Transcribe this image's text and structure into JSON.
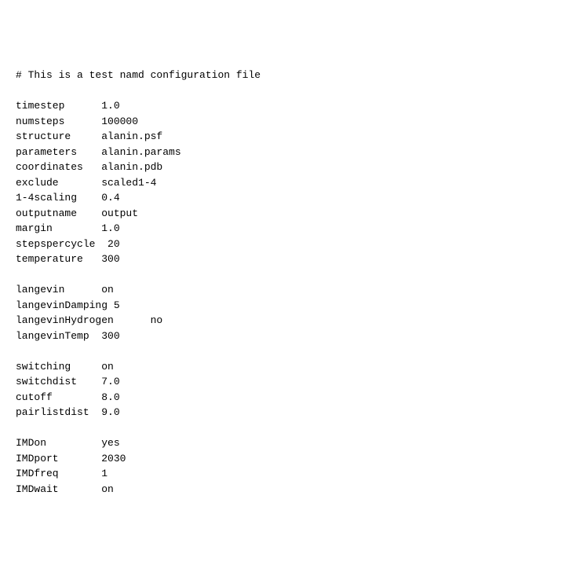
{
  "comment": "# This is a test namd configuration file",
  "blocks": [
    [
      {
        "key": "timestep",
        "pad": 14,
        "value": "1.0"
      },
      {
        "key": "numsteps",
        "pad": 14,
        "value": "100000"
      },
      {
        "key": "structure",
        "pad": 14,
        "value": "alanin.psf"
      },
      {
        "key": "parameters",
        "pad": 14,
        "value": "alanin.params"
      },
      {
        "key": "coordinates",
        "pad": 14,
        "value": "alanin.pdb"
      },
      {
        "key": "exclude",
        "pad": 14,
        "value": "scaled1-4"
      },
      {
        "key": "1-4scaling",
        "pad": 14,
        "value": "0.4"
      },
      {
        "key": "outputname",
        "pad": 14,
        "value": "output"
      },
      {
        "key": "margin",
        "pad": 14,
        "value": "1.0"
      },
      {
        "key": "stepspercycle",
        "pad": 15,
        "value": "20"
      },
      {
        "key": "temperature",
        "pad": 14,
        "value": "300"
      }
    ],
    [
      {
        "key": "langevin",
        "pad": 14,
        "value": "on"
      },
      {
        "key": "langevinDamping",
        "pad": 16,
        "value": "5"
      },
      {
        "key": "langevinHydrogen",
        "pad": 22,
        "value": "no"
      },
      {
        "key": "langevinTemp",
        "pad": 14,
        "value": "300"
      }
    ],
    [
      {
        "key": "switching",
        "pad": 14,
        "value": "on"
      },
      {
        "key": "switchdist",
        "pad": 14,
        "value": "7.0"
      },
      {
        "key": "cutoff",
        "pad": 14,
        "value": "8.0"
      },
      {
        "key": "pairlistdist",
        "pad": 14,
        "value": "9.0"
      }
    ],
    [
      {
        "key": "IMDon",
        "pad": 14,
        "value": "yes"
      },
      {
        "key": "IMDport",
        "pad": 14,
        "value": "2030"
      },
      {
        "key": "IMDfreq",
        "pad": 14,
        "value": "1"
      },
      {
        "key": "IMDwait",
        "pad": 14,
        "value": "on"
      }
    ]
  ]
}
